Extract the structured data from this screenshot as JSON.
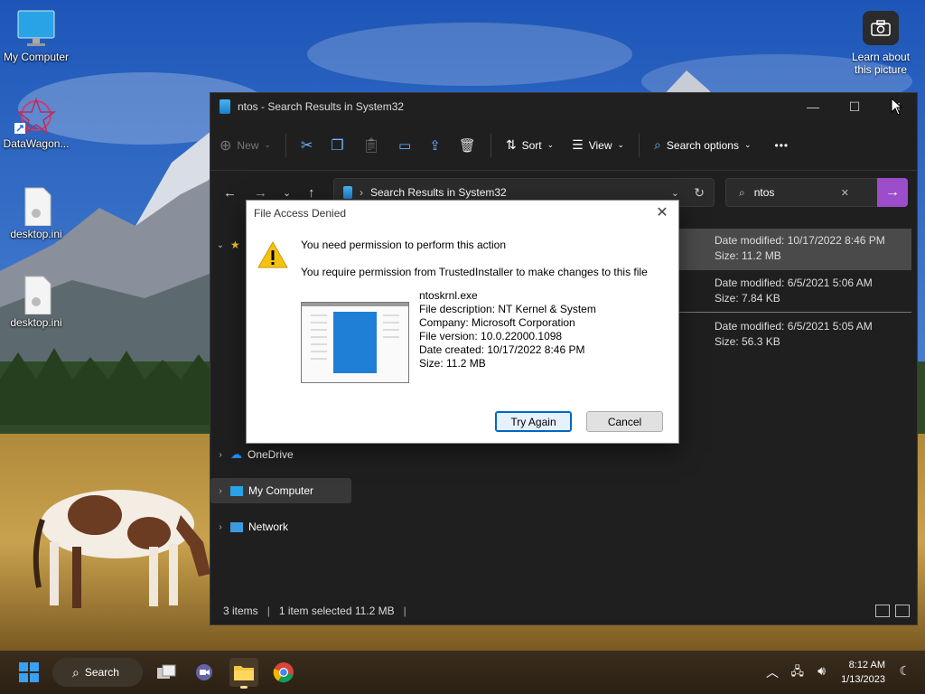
{
  "desktop": {
    "icons": [
      {
        "label": "My Computer"
      },
      {
        "label": "DataWagon..."
      },
      {
        "label": "desktop.ini"
      },
      {
        "label": "desktop.ini"
      }
    ],
    "corner_button": {
      "line1": "Learn about",
      "line2": "this picture"
    }
  },
  "explorer": {
    "title": "ntos - Search Results in System32",
    "toolbar": {
      "new_label": "New",
      "sort_label": "Sort",
      "view_label": "View",
      "search_options_label": "Search options",
      "more_label": "•••"
    },
    "address": {
      "path": "Search Results in System32"
    },
    "search": {
      "value": "ntos",
      "clear": "✕",
      "go": "→"
    },
    "nav": [
      {
        "label": "OneDrive"
      },
      {
        "label": "My Computer"
      },
      {
        "label": "Network"
      }
    ],
    "files": [
      {
        "date": "Date modified: 10/17/2022 8:46 PM",
        "size": "Size: 11.2 MB"
      },
      {
        "date": "Date modified: 6/5/2021 5:06 AM",
        "size": "Size: 7.84 KB"
      },
      {
        "date": "Date modified: 6/5/2021 5:05 AM",
        "size": "Size: 56.3 KB"
      }
    ],
    "status": {
      "items": "3 items",
      "selected": "1 item selected  11.2 MB"
    }
  },
  "dialog": {
    "title": "File Access Denied",
    "heading": "You need permission to perform this action",
    "message": "You require permission from TrustedInstaller to make changes to this file",
    "file": {
      "name": "ntoskrnl.exe",
      "description": "File description: NT Kernel & System",
      "company": "Company: Microsoft Corporation",
      "version": "File version: 10.0.22000.1098",
      "created": "Date created: 10/17/2022 8:46 PM",
      "size": "Size: 11.2 MB"
    },
    "buttons": {
      "retry": "Try Again",
      "cancel": "Cancel"
    }
  },
  "taskbar": {
    "search_label": "Search",
    "time": "8:12 AM",
    "date": "1/13/2023"
  },
  "colors": {
    "accent": "#9b4dca",
    "dialog_primary": "#0067c0",
    "window_bg": "#1f1f1f"
  }
}
